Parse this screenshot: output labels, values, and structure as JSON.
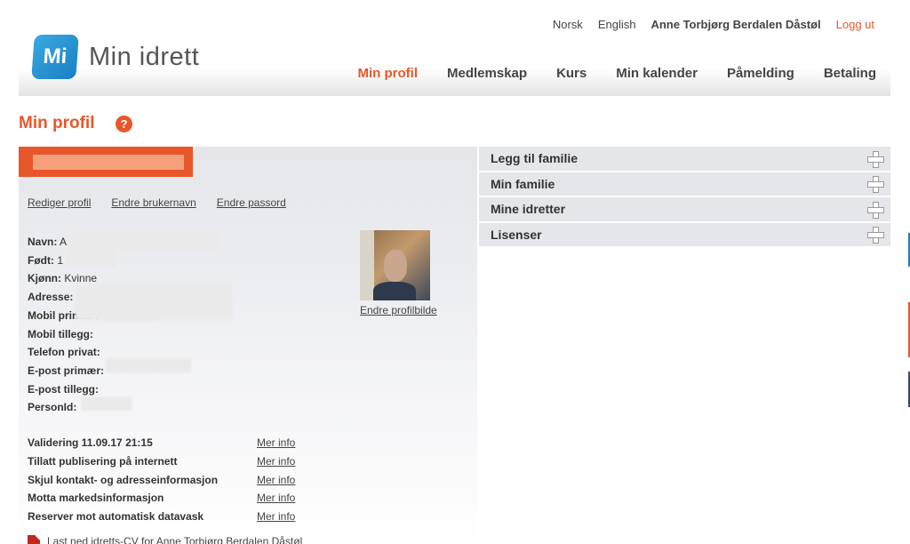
{
  "util": {
    "lang_no": "Norsk",
    "lang_en": "English",
    "user_name": "Anne Torbjørg Berdalen Dåstøl",
    "logout": "Logg ut"
  },
  "logo": {
    "mark": "Mi",
    "text": "Min idrett"
  },
  "nav": {
    "items": [
      "Min profil",
      "Medlemskap",
      "Kurs",
      "Min kalender",
      "Påmelding",
      "Betaling"
    ],
    "active": "Min profil"
  },
  "page": {
    "title": "Min profil",
    "help": "?"
  },
  "profile_links": {
    "edit_profile": "Rediger profil",
    "change_username": "Endre brukernavn",
    "change_password": "Endre passord"
  },
  "fields": [
    {
      "label": "Navn:",
      "value": "A"
    },
    {
      "label": "Født:",
      "value": "1"
    },
    {
      "label": "Kjønn:",
      "value": "Kvinne"
    },
    {
      "label": "Adresse:",
      "value": ""
    },
    {
      "label": "Mobil primær:",
      "value": ""
    },
    {
      "label": "Mobil tillegg:",
      "value": ""
    },
    {
      "label": "Telefon privat:",
      "value": ""
    },
    {
      "label": "E-post primær:",
      "value": ""
    },
    {
      "label": "E-post tillegg:",
      "value": ""
    },
    {
      "label": "PersonId:",
      "value": ""
    }
  ],
  "photo": {
    "change_label": "Endre profilbilde"
  },
  "settings": [
    {
      "label": "Validering 11.09.17 21:15",
      "link": "Mer info"
    },
    {
      "label": "Tillatt publisering på internett",
      "link": "Mer info"
    },
    {
      "label": "Skjul kontakt- og adresseinformasjon",
      "link": "Mer info"
    },
    {
      "label": "Motta markedsinformasjon",
      "link": "Mer info"
    },
    {
      "label": "Reserver mot automatisk datavask",
      "link": "Mer info"
    }
  ],
  "cv_link": "Last ned idretts-CV for Anne Torbjørg Berdalen Dåstøl",
  "accordion": [
    "Legg til familie",
    "Min familie",
    "Mine idretter",
    "Lisenser"
  ],
  "colors": {
    "accent": "#e8572a",
    "brand_blue": "#1a7fc4",
    "panel": "#e5e6ea"
  }
}
